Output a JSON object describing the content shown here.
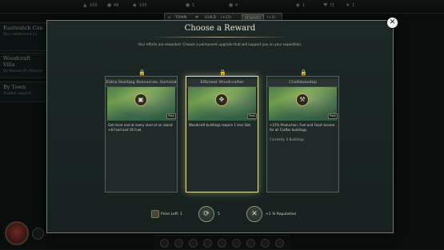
{
  "hud": {
    "resources": [
      "100",
      "48",
      "100",
      "5",
      "4",
      "1",
      "71",
      "1"
    ]
  },
  "tabs": [
    {
      "label": "TOWN"
    },
    {
      "label": "GUILD"
    },
    {
      "label": "(+12)"
    },
    {
      "label": "REWARD"
    },
    {
      "label": "(+1)"
    }
  ],
  "background_panels": [
    {
      "title": "Eastwatch Con",
      "sub": "Your settlement Lo"
    },
    {
      "title": "Woodcraft Villa",
      "sub": "By Woodcraft Alliance"
    },
    {
      "title": "By Town",
      "sub": "Traders request"
    }
  ],
  "modal": {
    "title": "Choose a Reward",
    "description": "Your efforts are rewarded. Choose a permanent upgrade that will support you on your expedition.",
    "close_symbol": "✕"
  },
  "cards": [
    {
      "title": "Extra Starting Resources: Survival",
      "icon": "crate-icon",
      "tag": "Pass",
      "text": "Get more and at every start of an island +8 Food and 16 Fuel.",
      "text2": ""
    },
    {
      "title": "Efficient Woodcrafter",
      "icon": "woodcrafter-icon",
      "tag": "Pass",
      "text": "Woodcraft buildings require 1 less Slot.",
      "text2": ""
    },
    {
      "title": "Craftmanship",
      "icon": "tool-icon",
      "tag": "Pass",
      "text": "+15% Production, Fuel and Food income for all Crafter buildings.",
      "text2": "Currently: 0 Buildings."
    }
  ],
  "footer": {
    "picks_left": "Picks Left: 1",
    "reroll_cost": "5",
    "reputation": "+1 % Reputation"
  }
}
